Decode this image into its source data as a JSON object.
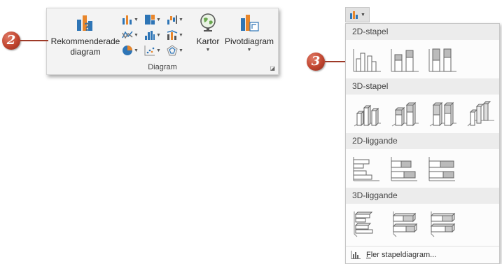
{
  "ribbon": {
    "recommended_label": "Rekommenderade diagram",
    "maps_label": "Kartor",
    "pivot_label": "Pivotdiagram",
    "group_label": "Diagram"
  },
  "callouts": {
    "ribbon_step": "2",
    "dropdown_step": "3"
  },
  "dropdown": {
    "sections": [
      {
        "title": "2D-stapel"
      },
      {
        "title": "3D-stapel"
      },
      {
        "title": "2D-liggande"
      },
      {
        "title": "3D-liggande"
      }
    ],
    "more_link_accel": "F",
    "more_link_rest": "ler stapeldiagram..."
  },
  "colors": {
    "badge": "#c0452f",
    "ribbon_bg": "#f3f3f3",
    "section_bg": "#ececec",
    "icon_blue": "#2e75b6",
    "icon_orange": "#e8862b"
  }
}
